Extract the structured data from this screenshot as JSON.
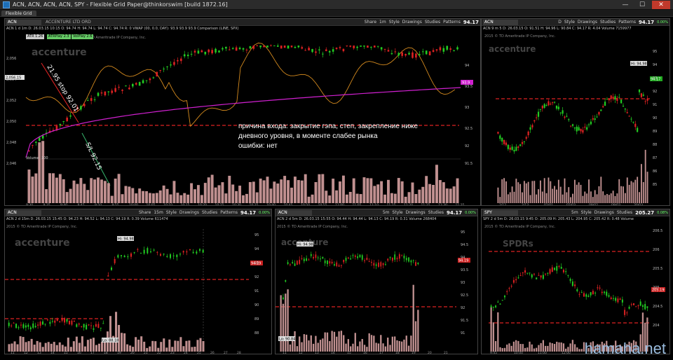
{
  "window": {
    "title": "ACN, ACN, ACN, ACN, SPY - Flexible Grid Paper@thinkorswim [build 1872.16]",
    "tab": "Flexible Grid"
  },
  "toolbar_labels": {
    "share": "Share",
    "style": "Style",
    "drawings": "Drawings",
    "studies": "Studies",
    "patterns": "Patterns"
  },
  "site_watermark": "hamaha.net",
  "copyright": "2015 © TD Ameritrade IP Company, Inc.",
  "brand_main": "accenture",
  "brand_spy": "SPDRs",
  "colors": {
    "up": "#22cc22",
    "down": "#dd2222",
    "level": "#dd2222",
    "comparison": "#d48a1e",
    "vwap": "#d020d0",
    "volume": "#c09090"
  },
  "panels": {
    "main": {
      "symbol": "ACN",
      "desc": "ACCENTURE LTD ORD",
      "tf": "1m",
      "price": "94.17",
      "info": "ACN 1 d 1m   D: 26.03.15 10:15   O: 94.74   H: 94.74   L: 94.74   C: 94.74   R: 0   VWAP (00, 0.0, DAY): 93.9   93.9   93.9   Comparison (LINE, SPX)",
      "studies": [
        "ATR 1.26",
        "ATRPlay 2.3",
        "VolPlay 2.6"
      ],
      "price_tag": "2,056.15",
      "vwap_tag": "93.9",
      "annotation_stop": "21.95 stop 92.01",
      "annotation_sl": "S/L 92.15",
      "annotation_text": [
        "причина входа: закрытие гэпа, степ, закрепление ниже",
        "дневного уровня, в моменте слабее рынка",
        "ошибки: нет"
      ],
      "volume_label": "Volume",
      "volume_value": "100",
      "left_ticks": [
        "2,056",
        "2,054",
        "2,052",
        "2,050",
        "2,048",
        "2,046"
      ],
      "right_ticks": [
        "94",
        "93.5",
        "93",
        "92.5",
        "92",
        "91.5"
      ],
      "time_ticks": [
        "9:30",
        "9:35",
        "9:40",
        "9:45",
        "9:50",
        "9:55",
        "10:00",
        "10:05",
        "10:10",
        "10:15",
        "10:20",
        "10:25",
        "10:30",
        "10:35",
        "10:40",
        "10:45",
        "10:50",
        "10:55",
        "11:00",
        "11:05",
        "11:10",
        "11:15",
        "11:20",
        "11:25",
        "11:30",
        "11:35"
      ]
    },
    "top_right": {
      "symbol": "ACN",
      "desc": "D",
      "tf": "1m",
      "price": "94.17",
      "chg": "0.00%",
      "info": "ACN 9 m 5   D: 26.03.15   O: 91.51   H: 94.96   L: 90.84   C: 94.17   R: 4.04   Volume 7159977",
      "hi_label": "Hi: 94.98",
      "last_tag": "94.17",
      "right_ticks": [
        "95",
        "94",
        "93",
        "92",
        "91",
        "90",
        "89",
        "88",
        "87",
        "86",
        "85"
      ],
      "date_ticks": [
        "2/12",
        "2/13",
        "02/01",
        "02/03",
        "09/02",
        "09/03",
        "30/03"
      ]
    },
    "bottom_left": {
      "symbol": "ACN",
      "desc": "",
      "tf": "15m",
      "price": "94.17",
      "chg": "0.00%",
      "info": "ACN 2 d 15m   D: 26.03.15 15:45   O: 94.23   H: 94.52   L: 94.13   C: 94.19   R: 0.39   Volume 611474",
      "hi_label": "Hi: 94.98",
      "lo_label": "Lo: 88.18",
      "last_tag": "94.19",
      "right_ticks": [
        "95",
        "94",
        "93",
        "92",
        "91",
        "90",
        "89",
        "88"
      ],
      "time_ticks": [
        "11",
        "12",
        "13",
        "14",
        "15",
        "16",
        "17",
        "18",
        "19",
        "20",
        "21",
        "22",
        "23",
        "24",
        "25",
        "26",
        "27",
        "28"
      ]
    },
    "bottom_mid": {
      "symbol": "ACN",
      "desc": "",
      "tf": "5m",
      "price": "94.17",
      "chg": "0.00%",
      "info": "ACN 2 d 5m   D: 26.03.15 15:55   O: 94.44   H: 94.44   L: 94.13   C: 94.19   R: 0.31   Volume 268404",
      "hi_label": "Hi: 94.98",
      "lo_label": "Lo: 90.84",
      "last_tag": "94.19",
      "right_ticks": [
        "95",
        "94.5",
        "94",
        "93.5",
        "93",
        "92.5",
        "92",
        "91.5",
        "91"
      ],
      "time_ticks": [
        "11",
        "12",
        "13",
        "14",
        "15",
        "16",
        "17",
        "18",
        "19",
        "20",
        "21"
      ]
    },
    "bottom_right": {
      "symbol": "SPY",
      "desc": "",
      "tf": "5m",
      "price": "205.27",
      "chg": "0.08%",
      "info": "SPY 2 d 5m   D: 26.03.15 9:45   O: 205.09   H: 205.43   L: 204.95   C: 205.42   R: 0.48   Volume",
      "last_tag": "205.19",
      "right_ticks": [
        "206.5",
        "206",
        "205.5",
        "205",
        "204.5",
        "204"
      ],
      "time_ticks": [
        "9:45",
        "10:00",
        "11:00",
        "12:00",
        "13:00",
        "14:00",
        "15:00"
      ]
    }
  }
}
